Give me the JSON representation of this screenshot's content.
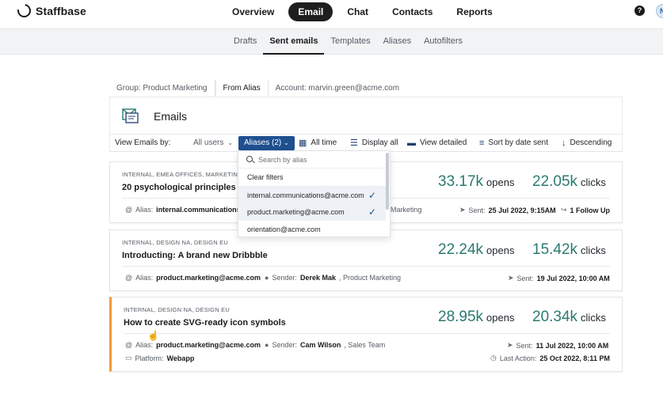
{
  "brand": {
    "name": "Staffbase"
  },
  "main_nav": [
    {
      "label": "Overview",
      "active": false
    },
    {
      "label": "Email",
      "active": true
    },
    {
      "label": "Chat",
      "active": false
    },
    {
      "label": "Contacts",
      "active": false
    },
    {
      "label": "Reports",
      "active": false
    }
  ],
  "help_icon": "?",
  "user_avatar": "N",
  "sub_nav": [
    {
      "label": "Drafts",
      "active": false
    },
    {
      "label": "Sent emails",
      "active": true
    },
    {
      "label": "Templates",
      "active": false
    },
    {
      "label": "Aliases",
      "active": false
    },
    {
      "label": "Autofilters",
      "active": false
    }
  ],
  "filters": {
    "group": "Group: Product Marketing",
    "from_alias": "From Alias",
    "account": "Account: marvin.green@acme.com"
  },
  "header": {
    "title": "Emails"
  },
  "toolbar": {
    "view_by": "View Emails by:",
    "all_users": "All users",
    "aliases": "Aliases (2)",
    "time": "All time",
    "display": "Display all",
    "view_mode": "View detailed",
    "sort": "Sort by date sent",
    "order": "Descending"
  },
  "dropdown": {
    "search_placeholder": "Search by alias",
    "clear": "Clear filters",
    "options": [
      {
        "label": "internal.communications@acme.com",
        "checked": true
      },
      {
        "label": "product.marketing@acme.com",
        "checked": true
      },
      {
        "label": "orientation@acme.com",
        "checked": false
      }
    ]
  },
  "emails": [
    {
      "tags": "INTERNAL, EMEA OFFICES, MARKETING",
      "subject": "20 psychological principles ap",
      "opens": "33.17k",
      "clicks": "22.05k",
      "opens_label": "opens",
      "clicks_label": "clicks",
      "alias_label": "Alias:",
      "alias": "internal.communications@",
      "sender_dept": "Marketing",
      "sent_label": "Sent:",
      "sent": "25 Jul 2022, 9:15AM",
      "followup": "1 Follow Up"
    },
    {
      "tags": "INTERNAL, DESIGN NA, DESIGN EU",
      "subject": "Introducting: A brand new Dribbble",
      "opens": "22.24k",
      "clicks": "15.42k",
      "opens_label": "opens",
      "clicks_label": "clicks",
      "alias_label": "Alias:",
      "alias": "product.marketing@acme.com",
      "sender_label": "Sender:",
      "sender": "Derek Mak",
      "sender_dept": ", Product Marketing",
      "sent_label": "Sent:",
      "sent": "19 Jul 2022, 10:00 AM"
    },
    {
      "tags": "INTERNAL, DESIGN NA, DESIGN EU",
      "subject": "How to create SVG-ready icon symbols",
      "opens": "28.95k",
      "clicks": "20.34k",
      "opens_label": "opens",
      "clicks_label": "clicks",
      "alias_label": "Alias:",
      "alias": "product.marketing@acme.com",
      "sender_label": "Sender:",
      "sender": "Cam Wilson",
      "sender_dept": ", Sales Team",
      "sent_label": "Sent:",
      "sent": "11 Jul 2022, 10:00 AM",
      "platform_label": "Platform:",
      "platform": "Webapp",
      "last_action_label": "Last Action:",
      "last_action": "25 Oct 2022, 8:11 PM"
    }
  ],
  "colors": {
    "accent": "#1e4f8f",
    "metric": "#2c7a6f",
    "highlight": "#f09a37"
  }
}
